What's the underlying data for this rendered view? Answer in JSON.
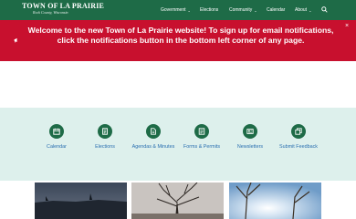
{
  "header": {
    "logo_title": "TOWN OF LA PRAIRIE",
    "logo_subtitle": "Rock County, Wisconsin",
    "nav": [
      {
        "label": "Government",
        "has_dropdown": true
      },
      {
        "label": "Elections",
        "has_dropdown": false
      },
      {
        "label": "Community",
        "has_dropdown": true
      },
      {
        "label": "Calendar",
        "has_dropdown": false
      },
      {
        "label": "About",
        "has_dropdown": true
      }
    ],
    "search_icon": "search-icon"
  },
  "alert": {
    "text": "Welcome to the new Town of La Prairie website! To sign up for email notifications, click the notifications button in the bottom left corner of any page.",
    "close_glyph": "×",
    "icon": "megaphone-icon"
  },
  "quick_links": [
    {
      "label": "Calendar",
      "icon": "calendar-icon"
    },
    {
      "label": "Elections",
      "icon": "ballot-icon"
    },
    {
      "label": "Agendas & Minutes",
      "icon": "document-icon"
    },
    {
      "label": "Forms & Permits",
      "icon": "form-icon"
    },
    {
      "label": "Newsletters",
      "icon": "newspaper-icon"
    },
    {
      "label": "Submit Feedback",
      "icon": "feedback-icon"
    }
  ],
  "colors": {
    "brand_green": "#1e6b47",
    "alert_red": "#c8102e",
    "quicklinks_bg": "#ddf0ec",
    "link_blue": "#2a6fb0"
  }
}
